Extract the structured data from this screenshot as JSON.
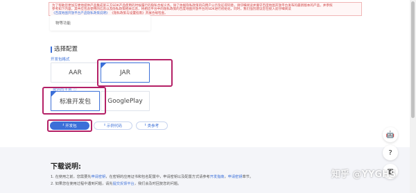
{
  "notice": {
    "line1": "为了帮助您更加方便地提供产品集成第三方SDK产品使用的时候履行的隐私合规义务。除了依据隐私政策的向用户公示及征得同意，请仔细阅读并遵守百度地图开放平台发布的最新版本的产品，并参照",
    "line2": "参考如下内容，其中应包含使用的信息以及隐私政策相关信息，将相应平台中的隐私政策的百度地图开放平台的SDK进行初始化，同时，我们强烈建议您在接入前仔细阅读",
    "line3": "《隐私政策与设置指南》开展合规检查。",
    "link": "《百度地图开放平台产品隐私政策说明》"
  },
  "function_card": {
    "text": "物等功能"
  },
  "section": {
    "title": "选择配置"
  },
  "format_group": {
    "label": "开发包格式",
    "options": [
      {
        "label": "AAR",
        "selected": false
      },
      {
        "label": "JAR",
        "selected": true
      }
    ]
  },
  "platform_group": {
    "label": "提供的平台 ⓘ",
    "options": [
      {
        "label": "标准开发包",
        "selected": true
      },
      {
        "label": "GooglePlay",
        "selected": false
      }
    ]
  },
  "actions": {
    "download": {
      "icon": "download-icon",
      "label": "开发包"
    },
    "sample": {
      "icon": "download-icon",
      "label": "示例代码"
    },
    "docs": {
      "icon": "download-icon",
      "label": "类参考"
    }
  },
  "download_notes": {
    "title": "下载说明:",
    "line1_parts": [
      "1. 在使用之前，您需要先",
      "申请密钥",
      "，在密钥的应用证书和包名配置中，申请密钥以及配置方式请参考",
      "开发指南",
      "，",
      "申请密钥",
      "章节。"
    ],
    "line2_parts": [
      "2. 如果您在使用过程中遇到问题，请先",
      "提交反馈平台",
      "，我们会及时回复您的问题。"
    ]
  },
  "side_buttons": [
    {
      "icon": "robot-icon",
      "glyph": "🤖"
    },
    {
      "icon": "help-icon",
      "glyph": "?"
    },
    {
      "icon": "qr-icon",
      "glyph": "▦"
    }
  ],
  "watermark": "知乎 @YYGHS",
  "colors": {
    "accent": "#3b6fd8",
    "highlight": "#b42066",
    "notice_border": "#f0b6b6",
    "bottom_band": "#f4f5f9"
  }
}
